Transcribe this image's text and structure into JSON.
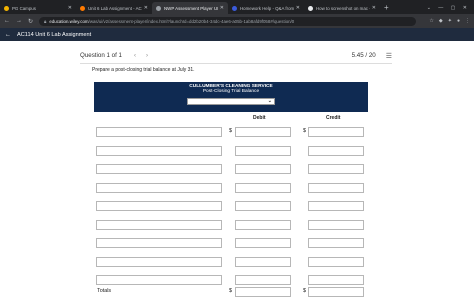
{
  "browser": {
    "tabs": [
      {
        "title": "PG Campus",
        "color": "#f4b400"
      },
      {
        "title": "Unit 6 Lab Assignment - AC114 ...",
        "color": "#ff7a00"
      },
      {
        "title": "NWP Assessment Player UI Ap...",
        "color": "#9aa0a6"
      },
      {
        "title": "Homework Help - Q&A from O...",
        "color": "#3b5bdb"
      },
      {
        "title": "How to screenshot on mac - Go...",
        "color": "#e8eaed"
      }
    ],
    "url_domain": "education.wiley.com",
    "url_path": "/was/ui/v2/assessment-player/index.html?launchId=dd2b20b4-34dc-4ae6-a05b-1ab8afd9f058#/question/0"
  },
  "header": {
    "title": "AC114 Unit 6 Lab Assignment"
  },
  "question": {
    "label": "Question 1 of 1",
    "points": "5.45 / 20"
  },
  "prompt": "Prepare a post-closing trial balance at July 31.",
  "table": {
    "company": "CULLUMBER'S CLEANING SERVICE",
    "subtitle": "Post-Closing Trial Balance",
    "debit_header": "Debit",
    "credit_header": "Credit",
    "currency": "$",
    "totals_label": "Totals"
  }
}
